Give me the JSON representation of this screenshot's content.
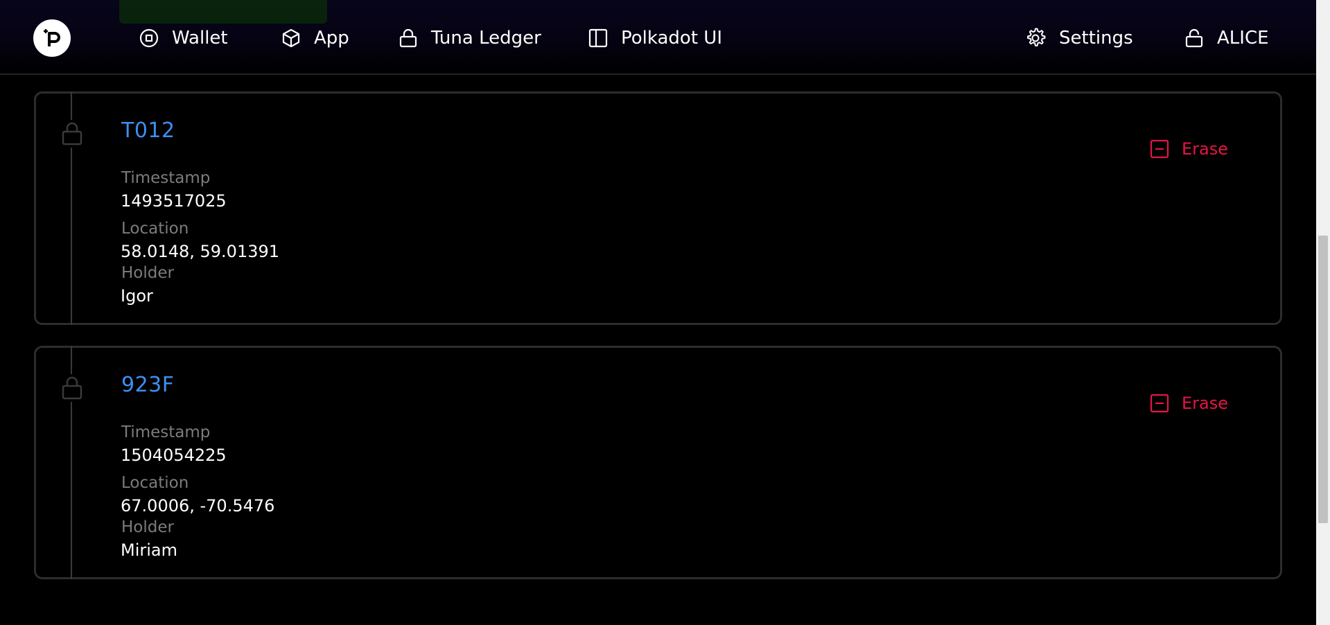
{
  "nav": {
    "wallet_label": "Wallet",
    "app_label": "App",
    "tuna_ledger_label": "Tuna Ledger",
    "polkadot_ui_label": "Polkadot UI",
    "settings_label": "Settings",
    "account_label": "ALICE"
  },
  "records": [
    {
      "id": "T012",
      "timestamp_label": "Timestamp",
      "timestamp": "1493517025",
      "location_label": "Location",
      "location": "58.0148, 59.01391",
      "holder_label": "Holder",
      "holder": "Igor",
      "erase_label": "Erase"
    },
    {
      "id": "923F",
      "timestamp_label": "Timestamp",
      "timestamp": "1504054225",
      "location_label": "Location",
      "location": "67.0006, -70.5476",
      "holder_label": "Holder",
      "holder": "Miriam",
      "erase_label": "Erase"
    }
  ],
  "colors": {
    "background": "#000000",
    "accent_blue": "#3d8ff0",
    "erase_red": "#e81448",
    "muted_label": "#7c7c7c"
  }
}
